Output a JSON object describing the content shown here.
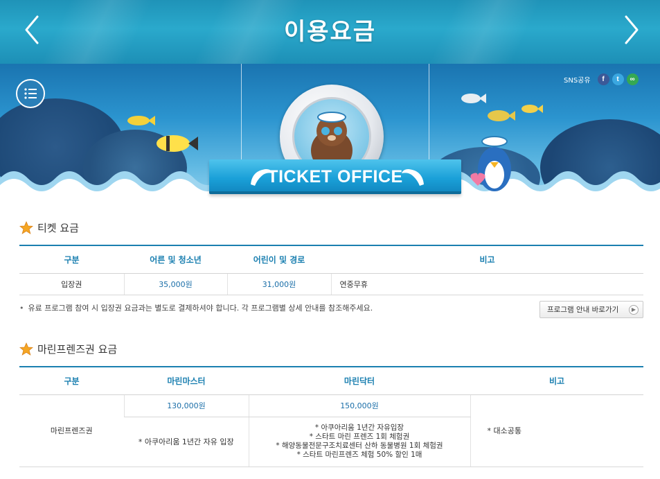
{
  "header": {
    "title": "이용요금",
    "prev_icon": "chevron-left-icon",
    "next_icon": "chevron-right-icon"
  },
  "banner": {
    "sns_label": "SNS공유",
    "sns": [
      {
        "name": "facebook-icon",
        "glyph": "f",
        "color": "#3b5998"
      },
      {
        "name": "twitter-icon",
        "glyph": "t",
        "color": "#3aa7e0"
      },
      {
        "name": "link-icon",
        "glyph": "∞",
        "color": "#35a853"
      }
    ],
    "sign": "TICKET OFFICE"
  },
  "ticket_section": {
    "title": "티켓 요금",
    "headers": [
      "구분",
      "어른 및 청소년",
      "어린이 및 경로",
      "비고"
    ],
    "rows": [
      {
        "label": "입장권",
        "adult": "35,000원",
        "child": "31,000원",
        "note": "연중무휴"
      }
    ],
    "note": "유료 프로그램 참여 시 입장권 요금과는 별도로 결제하셔야 합니다. 각 프로그램별 상세 안내를 참조해주세요.",
    "guide_button": "프로그램 안내 바로가기"
  },
  "marine_section": {
    "title": "마린프렌즈권 요금",
    "headers": [
      "구분",
      "마린마스터",
      "마린닥터",
      "비고"
    ],
    "row_label": "마린프렌즈권",
    "master_price": "130,000원",
    "doctor_price": "150,000원",
    "master_benefits": "* 아쿠아리움 1년간 자유 입장",
    "doctor_benefits": [
      "* 아쿠아리움 1년간 자유입장",
      "* 스타트 마린 프렌즈 1회 체험권",
      "* 해양동물전문구조치료센터 산하 동물병원 1회 체험권",
      "* 스타트 마린프렌즈 체험 50% 할인 1매"
    ],
    "note": "* 대소공통"
  },
  "colors": {
    "accent": "#1a7fb0",
    "sky": "#2aa9cc",
    "star": "#f5a623"
  }
}
